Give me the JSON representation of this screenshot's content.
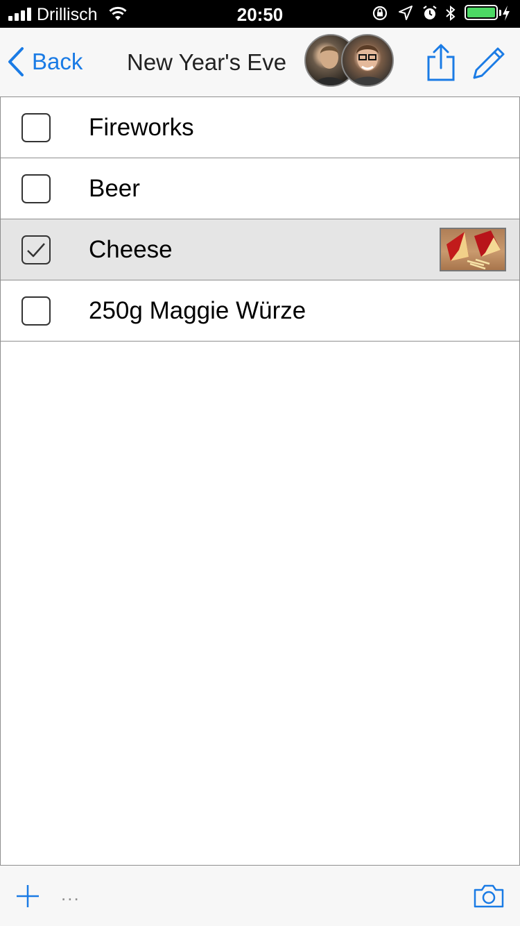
{
  "status_bar": {
    "carrier": "Drillisch",
    "time": "20:50",
    "battery_level": 1.0,
    "battery_color": "#4cd964"
  },
  "nav": {
    "back_label": "Back",
    "title": "New Year's Eve",
    "accent_color": "#1a7be5",
    "icons": [
      "chevron-left-icon",
      "share-icon",
      "pencil-icon"
    ]
  },
  "list": {
    "items": [
      {
        "label": "Fireworks",
        "checked": false
      },
      {
        "label": "Beer",
        "checked": false
      },
      {
        "label": "Cheese",
        "checked": true,
        "has_photo": true
      },
      {
        "label": "250g Maggie Würze",
        "checked": false
      }
    ]
  },
  "toolbar": {
    "more_label": "...",
    "icons": [
      "plus-icon",
      "camera-icon"
    ]
  }
}
